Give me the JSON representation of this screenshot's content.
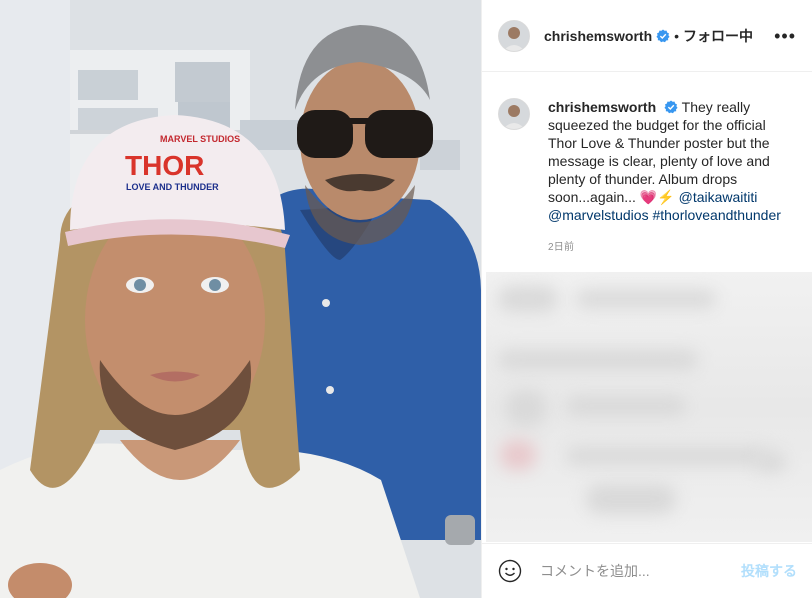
{
  "post": {
    "photo_logo_line1": "MARVEL STUDIOS",
    "photo_logo_line2": "THOR",
    "photo_logo_line3": "LOVE AND THUNDER"
  },
  "header": {
    "username": "chrishemsworth",
    "separator": "•",
    "follow_label": "フォロー中",
    "more_label": "•••"
  },
  "caption": {
    "username": "chrishemsworth",
    "text": "They really squeezed the budget for the official Thor Love & Thunder poster but the message is clear, plenty of love and plenty of thunder. Album drops soon...again... ",
    "emojis": "💗⚡",
    "tag1": "@taikawaititi",
    "tag2": "@marvelstudios",
    "tag3": "#thorloveandthunder",
    "time": "2日前"
  },
  "comment": {
    "placeholder": "コメントを追加...",
    "post_label": "投稿する"
  },
  "colors": {
    "verified_blue": "#3897f0",
    "link_blue": "#00376b",
    "post_disabled": "#b2dffc"
  }
}
